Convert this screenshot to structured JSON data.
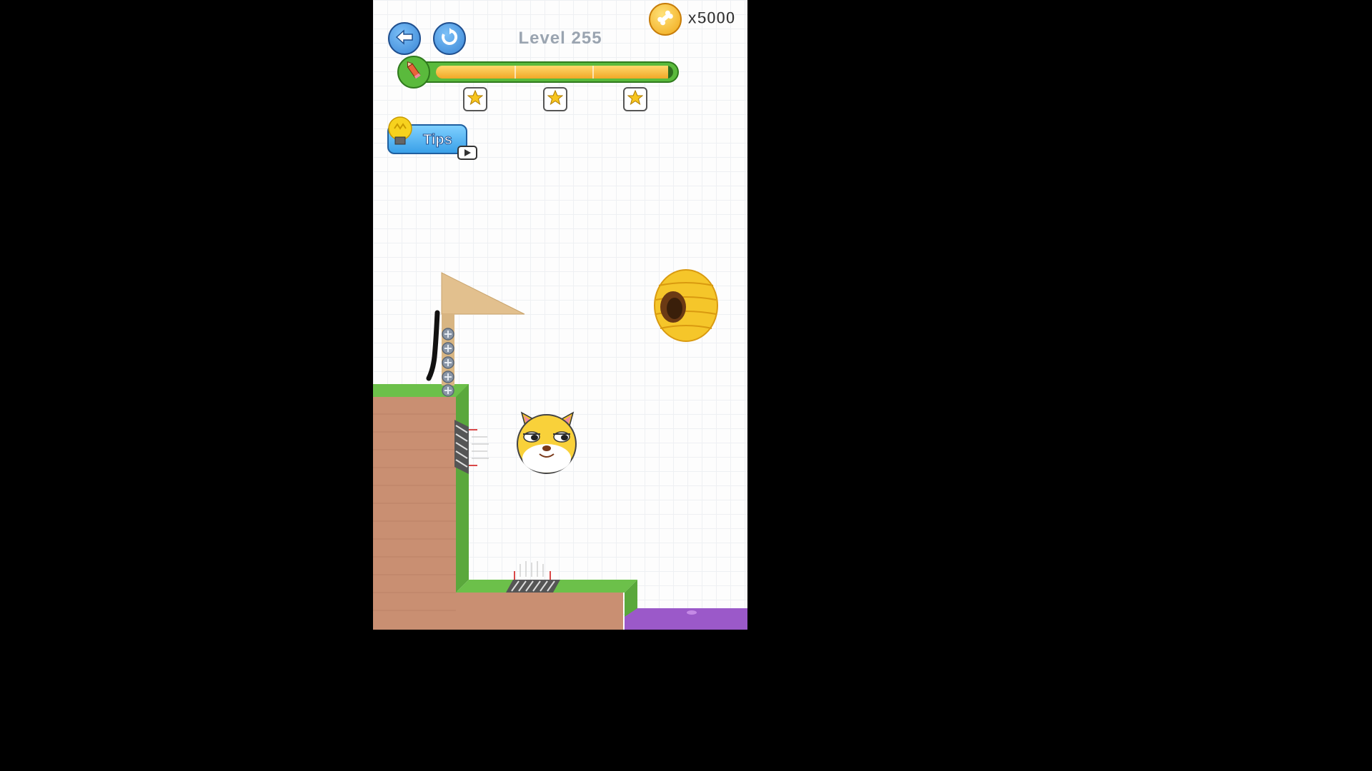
{
  "header": {
    "level_label": "Level 255",
    "coins": "x5000"
  },
  "ink": {
    "remaining_fraction": 0.98,
    "star_thresholds": [
      0.33,
      0.66
    ]
  },
  "stars": [
    {
      "name": "star-1"
    },
    {
      "name": "star-2"
    },
    {
      "name": "star-3"
    }
  ],
  "tips": {
    "label": "Tips"
  },
  "colors": {
    "grass": "#6cc04a",
    "brick": "#c98f72",
    "water": "#9b59c9",
    "accent_blue": "#3a86d6",
    "ink_fill": "#f2a828"
  },
  "icons": {
    "back": "back-arrow-icon",
    "restart": "restart-icon",
    "coin": "bone-coin-icon",
    "pencil": "pencil-icon",
    "star": "star-icon",
    "bulb": "lightbulb-icon",
    "video": "video-ad-icon"
  }
}
